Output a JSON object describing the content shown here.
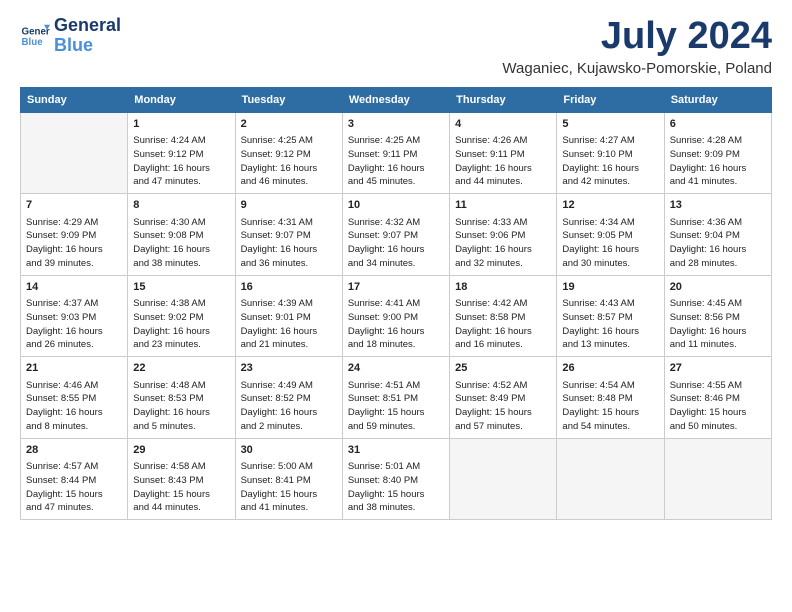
{
  "header": {
    "logo_line1": "General",
    "logo_line2": "Blue",
    "month": "July 2024",
    "location": "Waganiec, Kujawsko-Pomorskie, Poland"
  },
  "days_of_week": [
    "Sunday",
    "Monday",
    "Tuesday",
    "Wednesday",
    "Thursday",
    "Friday",
    "Saturday"
  ],
  "weeks": [
    [
      {
        "day": "",
        "info": ""
      },
      {
        "day": "1",
        "info": "Sunrise: 4:24 AM\nSunset: 9:12 PM\nDaylight: 16 hours\nand 47 minutes."
      },
      {
        "day": "2",
        "info": "Sunrise: 4:25 AM\nSunset: 9:12 PM\nDaylight: 16 hours\nand 46 minutes."
      },
      {
        "day": "3",
        "info": "Sunrise: 4:25 AM\nSunset: 9:11 PM\nDaylight: 16 hours\nand 45 minutes."
      },
      {
        "day": "4",
        "info": "Sunrise: 4:26 AM\nSunset: 9:11 PM\nDaylight: 16 hours\nand 44 minutes."
      },
      {
        "day": "5",
        "info": "Sunrise: 4:27 AM\nSunset: 9:10 PM\nDaylight: 16 hours\nand 42 minutes."
      },
      {
        "day": "6",
        "info": "Sunrise: 4:28 AM\nSunset: 9:09 PM\nDaylight: 16 hours\nand 41 minutes."
      }
    ],
    [
      {
        "day": "7",
        "info": "Sunrise: 4:29 AM\nSunset: 9:09 PM\nDaylight: 16 hours\nand 39 minutes."
      },
      {
        "day": "8",
        "info": "Sunrise: 4:30 AM\nSunset: 9:08 PM\nDaylight: 16 hours\nand 38 minutes."
      },
      {
        "day": "9",
        "info": "Sunrise: 4:31 AM\nSunset: 9:07 PM\nDaylight: 16 hours\nand 36 minutes."
      },
      {
        "day": "10",
        "info": "Sunrise: 4:32 AM\nSunset: 9:07 PM\nDaylight: 16 hours\nand 34 minutes."
      },
      {
        "day": "11",
        "info": "Sunrise: 4:33 AM\nSunset: 9:06 PM\nDaylight: 16 hours\nand 32 minutes."
      },
      {
        "day": "12",
        "info": "Sunrise: 4:34 AM\nSunset: 9:05 PM\nDaylight: 16 hours\nand 30 minutes."
      },
      {
        "day": "13",
        "info": "Sunrise: 4:36 AM\nSunset: 9:04 PM\nDaylight: 16 hours\nand 28 minutes."
      }
    ],
    [
      {
        "day": "14",
        "info": "Sunrise: 4:37 AM\nSunset: 9:03 PM\nDaylight: 16 hours\nand 26 minutes."
      },
      {
        "day": "15",
        "info": "Sunrise: 4:38 AM\nSunset: 9:02 PM\nDaylight: 16 hours\nand 23 minutes."
      },
      {
        "day": "16",
        "info": "Sunrise: 4:39 AM\nSunset: 9:01 PM\nDaylight: 16 hours\nand 21 minutes."
      },
      {
        "day": "17",
        "info": "Sunrise: 4:41 AM\nSunset: 9:00 PM\nDaylight: 16 hours\nand 18 minutes."
      },
      {
        "day": "18",
        "info": "Sunrise: 4:42 AM\nSunset: 8:58 PM\nDaylight: 16 hours\nand 16 minutes."
      },
      {
        "day": "19",
        "info": "Sunrise: 4:43 AM\nSunset: 8:57 PM\nDaylight: 16 hours\nand 13 minutes."
      },
      {
        "day": "20",
        "info": "Sunrise: 4:45 AM\nSunset: 8:56 PM\nDaylight: 16 hours\nand 11 minutes."
      }
    ],
    [
      {
        "day": "21",
        "info": "Sunrise: 4:46 AM\nSunset: 8:55 PM\nDaylight: 16 hours\nand 8 minutes."
      },
      {
        "day": "22",
        "info": "Sunrise: 4:48 AM\nSunset: 8:53 PM\nDaylight: 16 hours\nand 5 minutes."
      },
      {
        "day": "23",
        "info": "Sunrise: 4:49 AM\nSunset: 8:52 PM\nDaylight: 16 hours\nand 2 minutes."
      },
      {
        "day": "24",
        "info": "Sunrise: 4:51 AM\nSunset: 8:51 PM\nDaylight: 15 hours\nand 59 minutes."
      },
      {
        "day": "25",
        "info": "Sunrise: 4:52 AM\nSunset: 8:49 PM\nDaylight: 15 hours\nand 57 minutes."
      },
      {
        "day": "26",
        "info": "Sunrise: 4:54 AM\nSunset: 8:48 PM\nDaylight: 15 hours\nand 54 minutes."
      },
      {
        "day": "27",
        "info": "Sunrise: 4:55 AM\nSunset: 8:46 PM\nDaylight: 15 hours\nand 50 minutes."
      }
    ],
    [
      {
        "day": "28",
        "info": "Sunrise: 4:57 AM\nSunset: 8:44 PM\nDaylight: 15 hours\nand 47 minutes."
      },
      {
        "day": "29",
        "info": "Sunrise: 4:58 AM\nSunset: 8:43 PM\nDaylight: 15 hours\nand 44 minutes."
      },
      {
        "day": "30",
        "info": "Sunrise: 5:00 AM\nSunset: 8:41 PM\nDaylight: 15 hours\nand 41 minutes."
      },
      {
        "day": "31",
        "info": "Sunrise: 5:01 AM\nSunset: 8:40 PM\nDaylight: 15 hours\nand 38 minutes."
      },
      {
        "day": "",
        "info": ""
      },
      {
        "day": "",
        "info": ""
      },
      {
        "day": "",
        "info": ""
      }
    ]
  ]
}
